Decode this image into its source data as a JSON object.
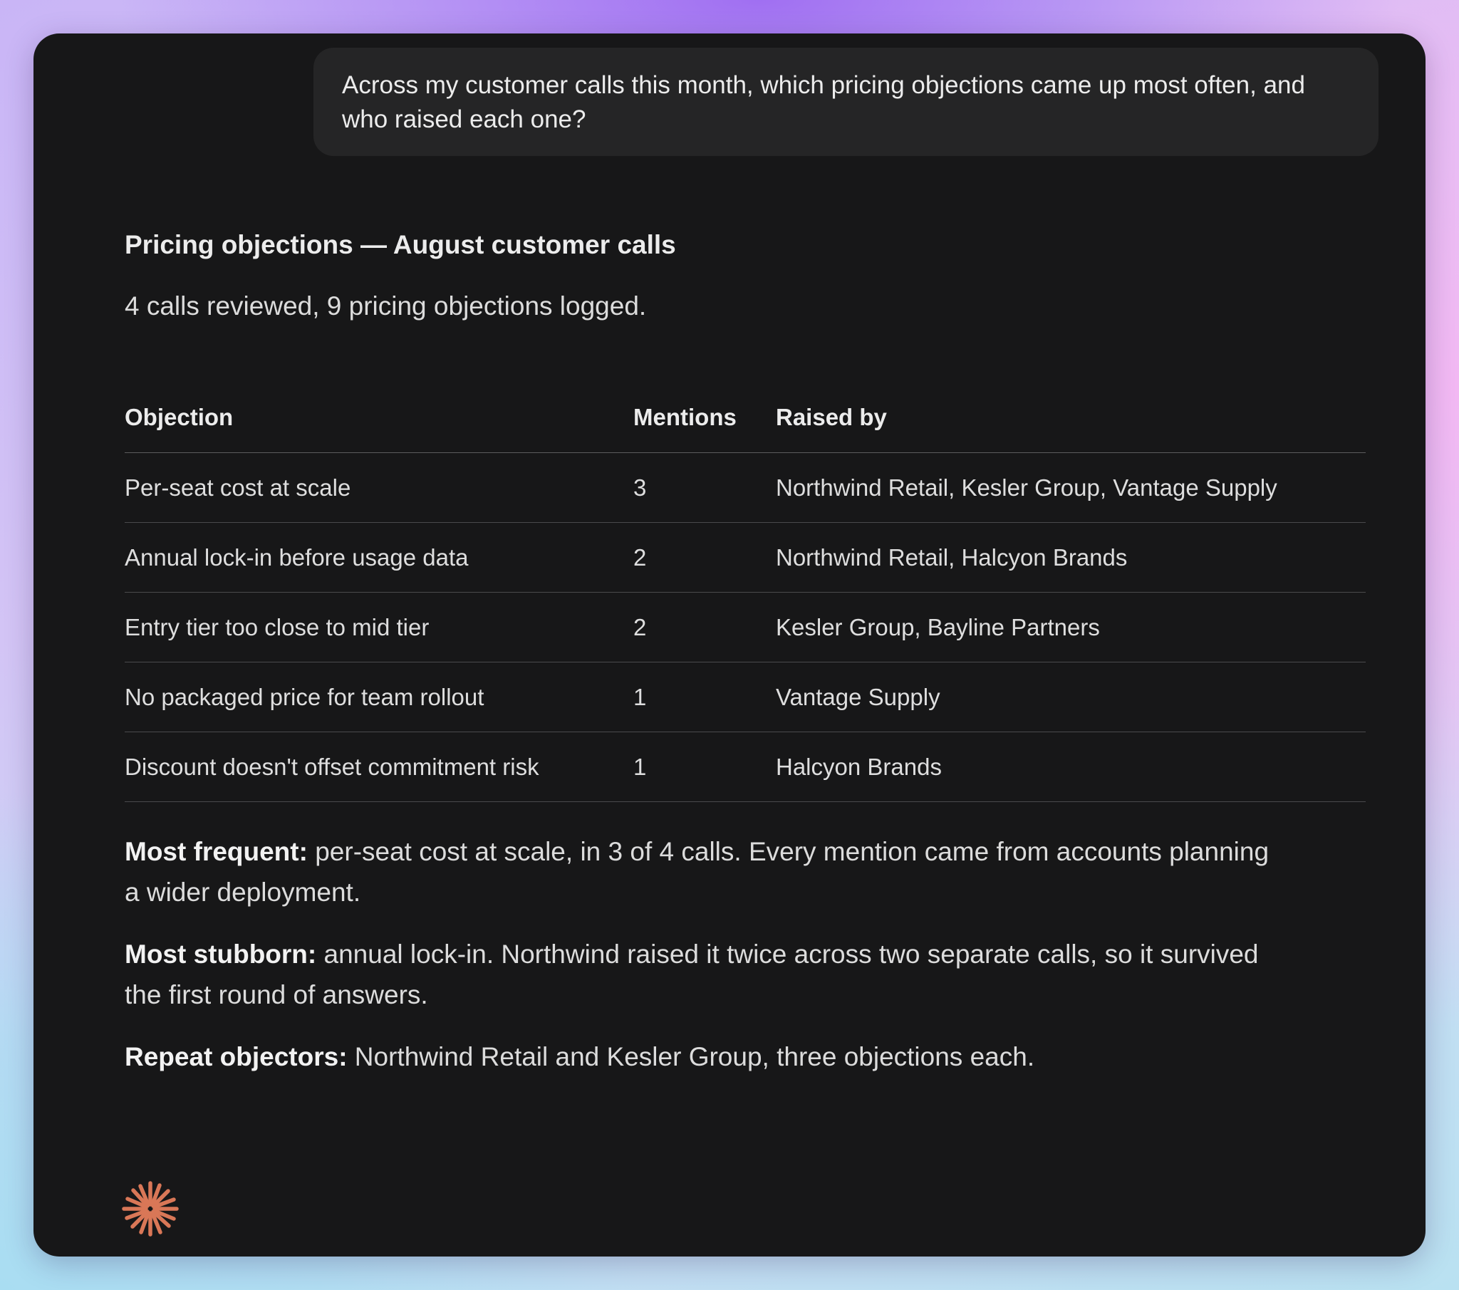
{
  "conversation": {
    "user_message": "Across my customer calls this month, which pricing objections came up most often, and who raised each one?"
  },
  "response": {
    "title": "Pricing objections — August customer calls",
    "summary": "4 calls reviewed, 9 pricing objections logged.",
    "table": {
      "headers": [
        "Objection",
        "Mentions",
        "Raised by"
      ],
      "rows": [
        {
          "objection": "Per-seat cost at scale",
          "mentions": "3",
          "raised_by": "Northwind Retail, Kesler Group, Vantage Supply"
        },
        {
          "objection": "Annual lock-in before usage data",
          "mentions": "2",
          "raised_by": "Northwind Retail, Halcyon Brands"
        },
        {
          "objection": "Entry tier too close to mid tier",
          "mentions": "2",
          "raised_by": "Kesler Group, Bayline Partners"
        },
        {
          "objection": "No packaged price for team rollout",
          "mentions": "1",
          "raised_by": "Vantage Supply"
        },
        {
          "objection": "Discount doesn't offset commitment risk",
          "mentions": "1",
          "raised_by": "Halcyon Brands"
        }
      ]
    },
    "notes": [
      {
        "label": "Most frequent:",
        "text": " per-seat cost at scale, in 3 of 4 calls. Every mention came from accounts planning a wider deployment."
      },
      {
        "label": "Most stubborn:",
        "text": " annual lock-in. Northwind raised it twice across two separate calls, so it survived the first round of answers."
      },
      {
        "label": "Repeat objectors:",
        "text": " Northwind Retail and Kesler Group, three objections each."
      }
    ]
  },
  "icons": {
    "assistant_logo": "sparkle-asterisk-icon"
  },
  "colors": {
    "card_background": "#171718",
    "bubble_background": "#252526",
    "logo_accent": "#d97757"
  }
}
